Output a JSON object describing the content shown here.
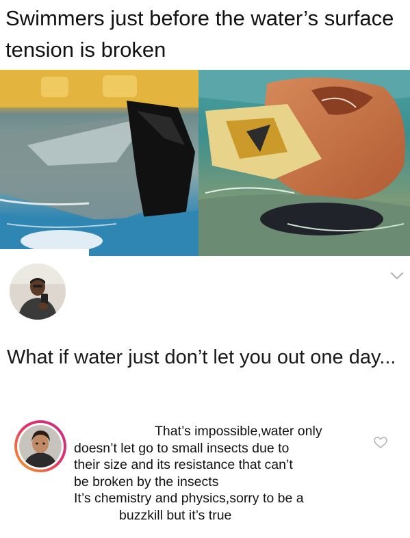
{
  "post": {
    "title": "Swimmers just before the water’s surface tension is broken"
  },
  "reply": {
    "text": "What if water just don’t let you out one day..."
  },
  "comment": {
    "lines": [
      "That’s impossible,water only",
      "doesn’t let go to small insects due to",
      "their size and its resistance that can’t",
      "be broken by the insects",
      "It’s chemistry and physics,sorry to be a",
      "buzzkill but it’s true"
    ]
  },
  "icons": {
    "chevron": "chevron-down-icon",
    "heart": "heart-outline-icon"
  },
  "colors": {
    "story_ring_start": "#f5a623",
    "story_ring_end": "#c13584",
    "icon_gray": "#b0b0b0"
  }
}
